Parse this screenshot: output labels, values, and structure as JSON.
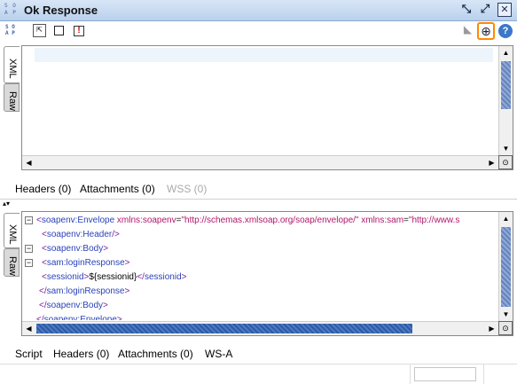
{
  "window": {
    "title": "Ok Response",
    "buttons": [
      "restore-icon",
      "detach-icon",
      "close-icon"
    ]
  },
  "toolbar": {
    "left_icons": [
      "soap-icon",
      "open-icon",
      "checkbox-icon",
      "alert-icon"
    ],
    "right_icons": [
      "tool-icon",
      "crosshair-icon",
      "help-icon"
    ]
  },
  "request_panel": {
    "vertical_tabs": [
      {
        "label": "XML"
      },
      {
        "label": "Raw"
      }
    ],
    "bottom_tabs": [
      {
        "label": "Headers (0)",
        "disabled": false
      },
      {
        "label": "Attachments (0)",
        "disabled": false
      },
      {
        "label": "WSS (0)",
        "disabled": true
      }
    ]
  },
  "response_panel": {
    "vertical_tabs": [
      {
        "label": "XML"
      },
      {
        "label": "Raw"
      }
    ],
    "xml_lines": [
      {
        "fold": "−",
        "indent": 0,
        "parts": [
          [
            "tag",
            "<"
          ],
          [
            "tagname",
            "soapenv:Envelope"
          ],
          [
            "txt",
            " "
          ],
          [
            "attr",
            "xmlns:soapenv"
          ],
          [
            "aval",
            "="
          ],
          [
            "attr",
            "\"http://schemas.xmlsoap.org/soap/envelope/\""
          ],
          [
            "txt",
            " "
          ],
          [
            "attr",
            "xmlns:sam"
          ],
          [
            "aval",
            "="
          ],
          [
            "attr",
            "\"http://www.s"
          ]
        ]
      },
      {
        "fold": "",
        "indent": 1,
        "parts": [
          [
            "tag",
            "<"
          ],
          [
            "tagname",
            "soapenv:Header"
          ],
          [
            "tag",
            "/>"
          ]
        ]
      },
      {
        "fold": "−",
        "indent": 1,
        "parts": [
          [
            "tag",
            "<"
          ],
          [
            "tagname",
            "soapenv:Body"
          ],
          [
            "tag",
            ">"
          ]
        ]
      },
      {
        "fold": "−",
        "indent": 1,
        "parts": [
          [
            "tag",
            "<"
          ],
          [
            "tagname",
            "sam:loginResponse"
          ],
          [
            "tag",
            ">"
          ]
        ]
      },
      {
        "fold": "",
        "indent": 1,
        "parts": [
          [
            "tag",
            "<"
          ],
          [
            "tagname",
            "sessionid"
          ],
          [
            "tag",
            ">"
          ],
          [
            "txt",
            "${sessionid}"
          ],
          [
            "tag",
            "</"
          ],
          [
            "tagname",
            "sessionid"
          ],
          [
            "tag",
            ">"
          ]
        ]
      },
      {
        "fold": "",
        "indent": 0.5,
        "parts": [
          [
            "tag",
            "</"
          ],
          [
            "tagname",
            "sam:loginResponse"
          ],
          [
            "tag",
            ">"
          ]
        ]
      },
      {
        "fold": "",
        "indent": 0.5,
        "parts": [
          [
            "tag",
            "</"
          ],
          [
            "tagname",
            "soapenv:Body"
          ],
          [
            "tag",
            ">"
          ]
        ]
      },
      {
        "fold": "",
        "indent": 0,
        "parts": [
          [
            "tag",
            "</"
          ],
          [
            "tagname",
            "soapenv:Envelope"
          ],
          [
            "tag",
            ">"
          ]
        ]
      }
    ],
    "bottom_tabs": [
      {
        "label": "Script"
      },
      {
        "label": "Headers (0)"
      },
      {
        "label": "Attachments (0)"
      },
      {
        "label": "WS-A"
      }
    ]
  },
  "colors": {
    "accent_orange": "#ff8a00",
    "titlebar": "#c8dbf2",
    "xml_tag": "#2b43b8",
    "xml_attr": "#b0176b"
  }
}
